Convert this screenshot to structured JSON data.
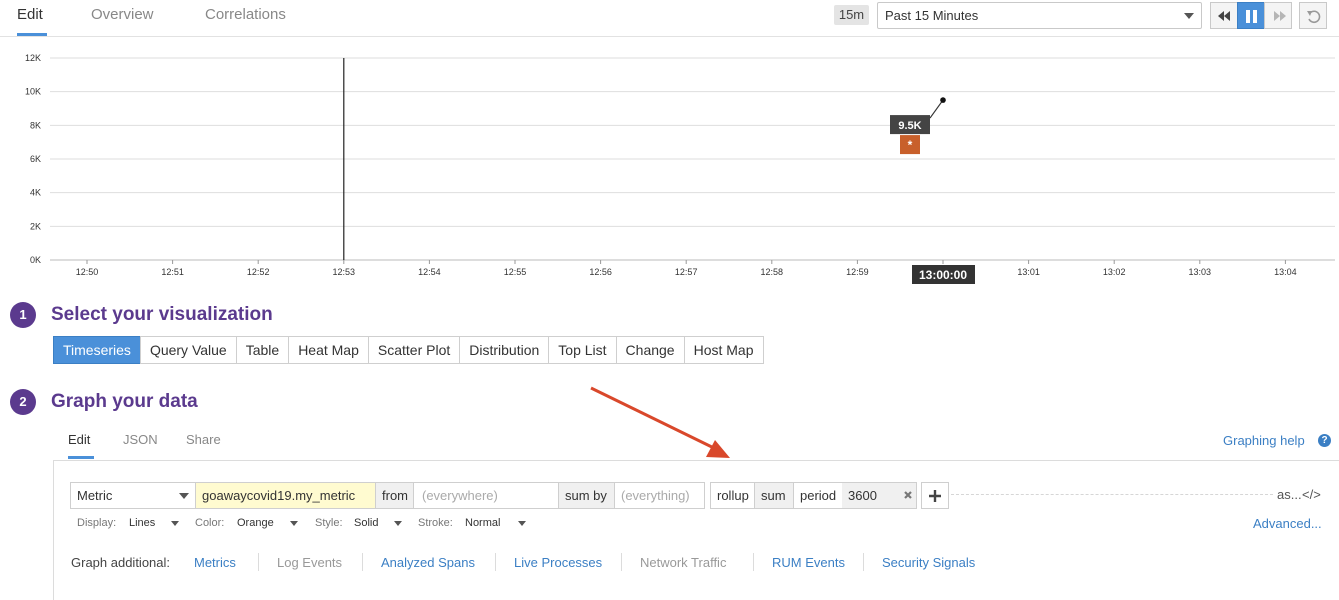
{
  "tabs": [
    "Edit",
    "Overview",
    "Correlations"
  ],
  "time_controls": {
    "range_badge": "15m",
    "range_select": "Past 15 Minutes"
  },
  "chart_data": {
    "type": "line",
    "x_ticks": [
      "12:50",
      "12:51",
      "12:52",
      "12:53",
      "12:54",
      "12:55",
      "12:56",
      "12:57",
      "12:58",
      "12:59",
      "13:00",
      "13:01",
      "13:02",
      "13:03",
      "13:04"
    ],
    "y_ticks": [
      "0K",
      "2K",
      "4K",
      "6K",
      "8K",
      "10K",
      "12K"
    ],
    "ylim": [
      0,
      12000
    ],
    "grid": true,
    "series": [
      {
        "values": [
          {
            "x": "13:00",
            "y": 9500
          }
        ]
      }
    ],
    "cursor_x": "12:53",
    "tooltip": {
      "value": "9.5K",
      "marker": "*",
      "color": "#c8602b"
    },
    "x_highlight_label": "13:00:00"
  },
  "section1": {
    "number": "1",
    "title": "Select your visualization",
    "viz_types": [
      "Timeseries",
      "Query Value",
      "Table",
      "Heat Map",
      "Scatter Plot",
      "Distribution",
      "Top List",
      "Change",
      "Host Map"
    ],
    "selected": "Timeseries"
  },
  "section2": {
    "number": "2",
    "title": "Graph your data",
    "tabs": [
      "Edit",
      "JSON",
      "Share"
    ],
    "help_link": "Graphing help",
    "help_icon": "?"
  },
  "query": {
    "type": "Metric",
    "metric": "goawaycovid19.my_metric",
    "from_label": "from",
    "from_placeholder": "(everywhere)",
    "sum_by_label": "sum by",
    "sum_by_placeholder": "(everything)",
    "rollup_label": "rollup",
    "rollup_func": "sum",
    "period_label": "period",
    "period_value": "3600",
    "as_label": "as...",
    "code_icon": "</>"
  },
  "display_options": {
    "display_label": "Display:",
    "display_value": "Lines",
    "color_label": "Color:",
    "color_value": "Orange",
    "style_label": "Style:",
    "style_value": "Solid",
    "stroke_label": "Stroke:",
    "stroke_value": "Normal",
    "advanced": "Advanced..."
  },
  "graph_additional": {
    "label": "Graph additional:",
    "items": [
      {
        "label": "Metrics",
        "enabled": true
      },
      {
        "label": "Log Events",
        "enabled": false
      },
      {
        "label": "Analyzed Spans",
        "enabled": true
      },
      {
        "label": "Live Processes",
        "enabled": true
      },
      {
        "label": "Network Traffic",
        "enabled": false
      },
      {
        "label": "RUM Events",
        "enabled": true
      },
      {
        "label": "Security Signals",
        "enabled": true
      }
    ]
  },
  "annotation": {
    "arrow_color": "#d9482b"
  }
}
